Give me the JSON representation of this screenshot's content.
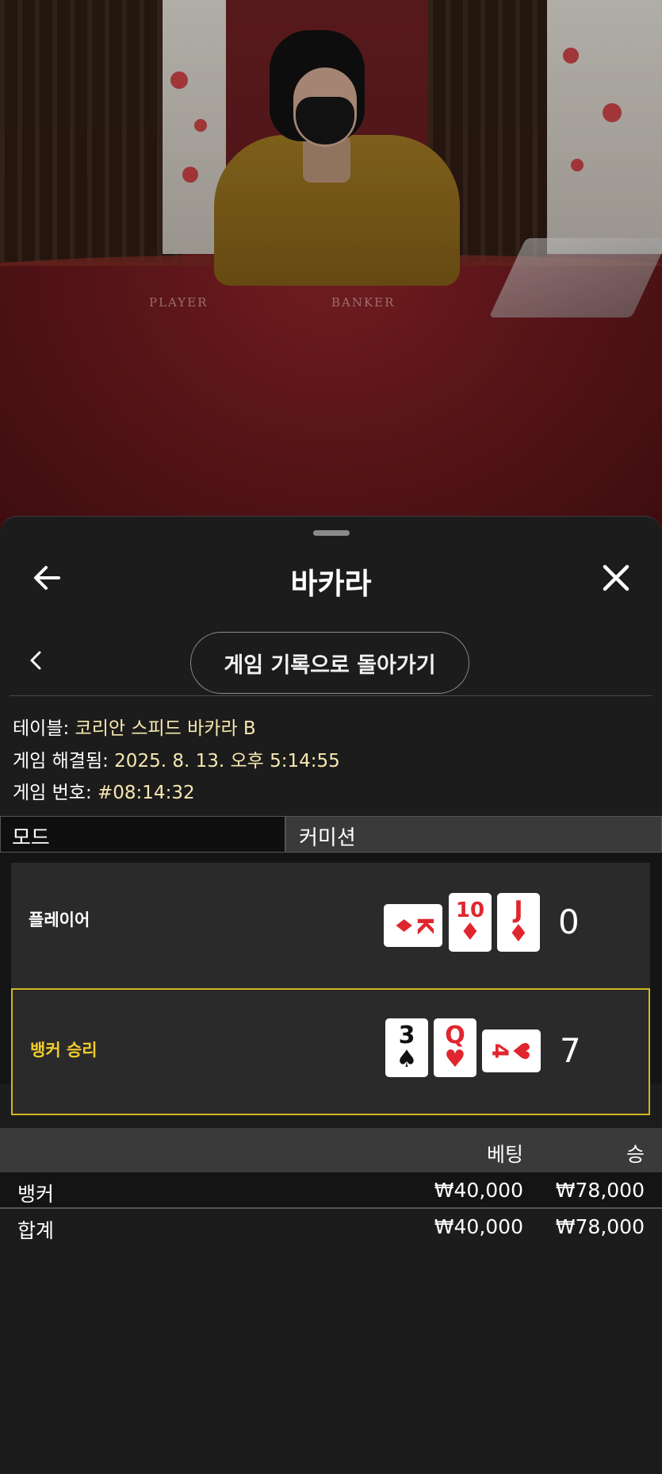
{
  "video": {
    "felt_player_label": "PLAYER",
    "felt_banker_label": "BANKER"
  },
  "sheet": {
    "title": "바카라",
    "back_icon": "arrow-left-icon",
    "close_icon": "close-icon",
    "history_button": "게임 기록으로 돌아가기",
    "chevron_icon": "chevron-left-icon"
  },
  "info": {
    "table_label": "테이블: ",
    "table_value": "코리안 스피드 바카라 B",
    "resolved_label": "게임 해결됨: ",
    "resolved_value": "2025. 8. 13. 오후 5:14:55",
    "number_label": "게임 번호: ",
    "number_value": "#08:14:32"
  },
  "tabs": {
    "mode": "모드",
    "commission": "커미션"
  },
  "hands": {
    "player": {
      "label": "플레이어",
      "score": "0",
      "cards": [
        {
          "rank": "K",
          "suit": "♦",
          "color": "#e0262d",
          "orientation": "horizontal"
        },
        {
          "rank": "10",
          "suit": "♦",
          "color": "#e0262d",
          "orientation": "vertical"
        },
        {
          "rank": "J",
          "suit": "♦",
          "color": "#e0262d",
          "orientation": "vertical"
        }
      ]
    },
    "banker": {
      "label": "뱅커 승리",
      "score": "7",
      "highlight_color": "#d4b61f",
      "cards": [
        {
          "rank": "3",
          "suit": "♠",
          "color": "#111111",
          "orientation": "vertical"
        },
        {
          "rank": "Q",
          "suit": "♥",
          "color": "#e0262d",
          "orientation": "vertical"
        },
        {
          "rank": "4",
          "suit": "♥",
          "color": "#e0262d",
          "orientation": "horizontal"
        }
      ]
    }
  },
  "bets": {
    "header_bet": "베팅",
    "header_win": "승",
    "rows": [
      {
        "label": "뱅커",
        "bet": "₩40,000",
        "win": "₩78,000"
      },
      {
        "label": "합계",
        "bet": "₩40,000",
        "win": "₩78,000"
      }
    ]
  }
}
